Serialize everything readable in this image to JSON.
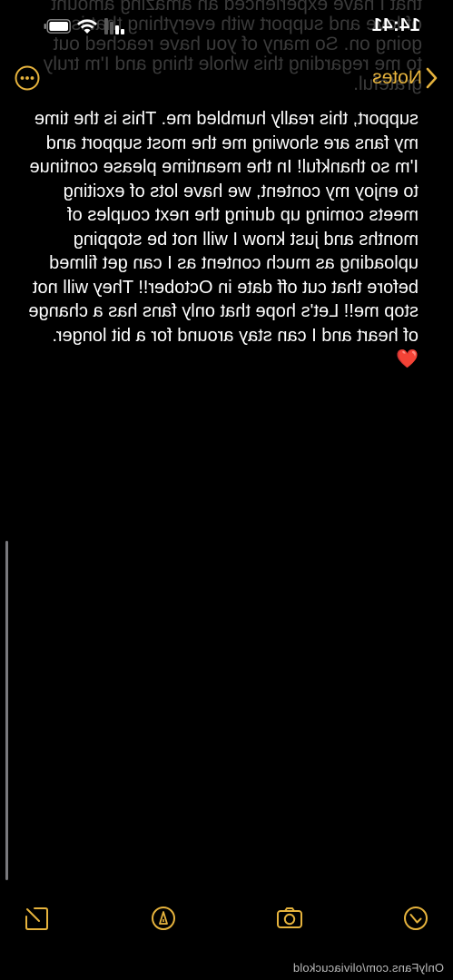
{
  "status_bar": {
    "time": "14:41"
  },
  "nav": {
    "back_label": "Notes",
    "back_icon": "chevron-left-icon",
    "more_icon": "ellipsis-circle-icon"
  },
  "ghost_text": "that I have experienced an amazing amount of love and support with everything that is going on. So many of you have reached out to me regarding this whole thing and I'm truly grateful.",
  "note": {
    "body": "support, this really humbled me. This is the time my fans are showing me the most support and I'm so thankful! In the meantime please continue to enjoy my content, we have lots of exciting meets coming up during the next couples of months and just know I will not be stopping uploading as much content as I can get filmed before that cut off date in October!! They will not stop me!! Let's hope that only fans has a change of heart and I can stay around for a bit longer.",
    "emoji": "❤️"
  },
  "toolbar": {
    "items": [
      {
        "icon": "checklist-icon"
      },
      {
        "icon": "camera-icon"
      },
      {
        "icon": "markup-pen-icon"
      },
      {
        "icon": "compose-icon"
      }
    ]
  },
  "watermark": "OnlyFans.com/oliviacuckold",
  "colors": {
    "accent": "#e6b33d",
    "background": "#000000",
    "text": "#ffffff",
    "heart": "#e0302c"
  }
}
